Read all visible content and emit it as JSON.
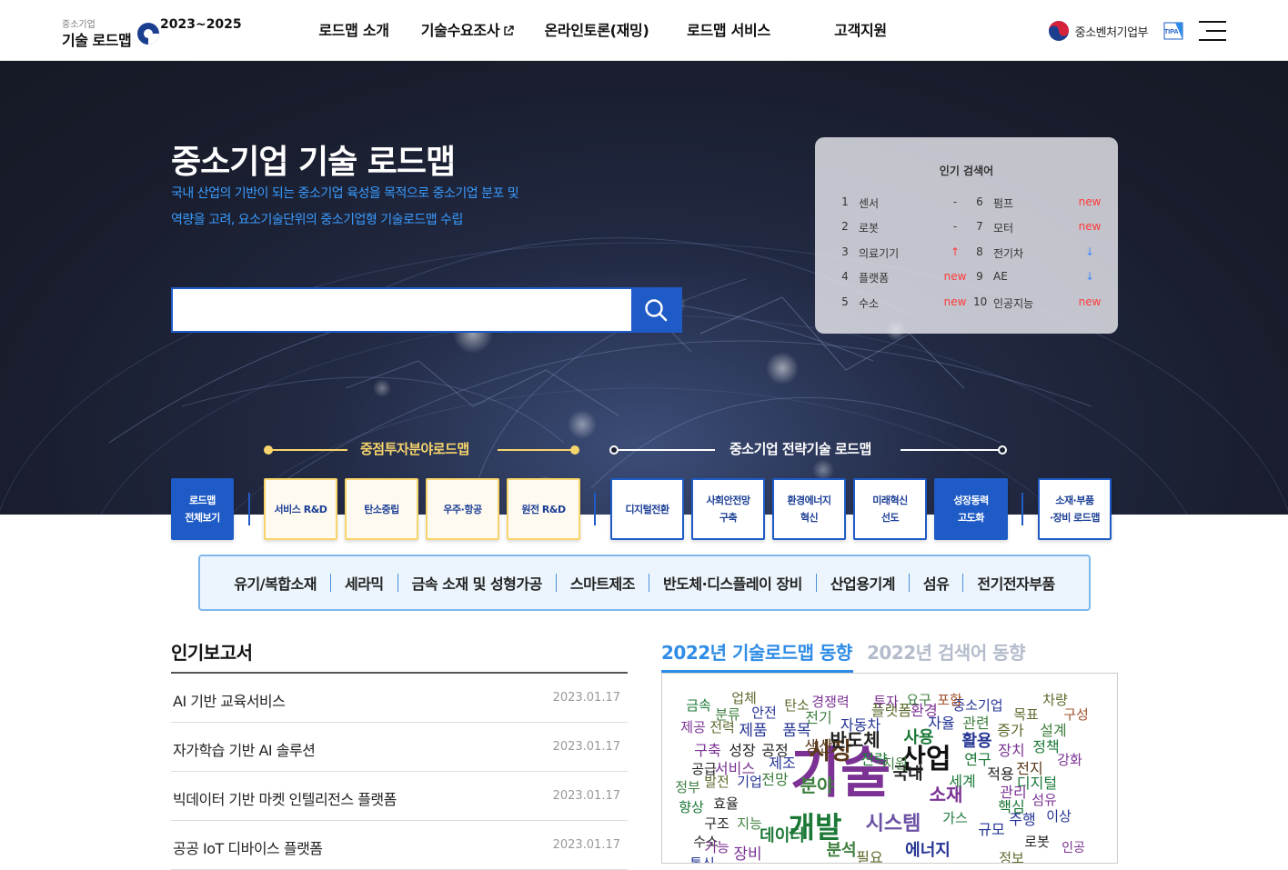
{
  "header": {
    "logo_small": "중소기업",
    "logo_main": "기술 로드맵",
    "logo_years": "2023~2025",
    "nav": [
      "로드맵 소개",
      "기술수요조사",
      "온라인토론(재밍)",
      "로드맵 서비스",
      "고객지원"
    ],
    "ministry": "중소벤처기업부",
    "tipa": "TIPA"
  },
  "hero": {
    "title": "중소기업 기술 로드맵",
    "desc1": "국내 산업의 기반이 되는 중소기업 육성을 목적으로 중소기업 분포 및",
    "desc2": "역량을 고려, 요소기술단위의 중소기업형 기술로드맵 수립",
    "search_placeholder": ""
  },
  "popular": {
    "title": "인기 검색어",
    "items": [
      {
        "rank": "1",
        "word": "센서",
        "trend": "-"
      },
      {
        "rank": "2",
        "word": "로봇",
        "trend": "-"
      },
      {
        "rank": "3",
        "word": "의료기기",
        "trend": "↑"
      },
      {
        "rank": "4",
        "word": "플랫폼",
        "trend": "new"
      },
      {
        "rank": "5",
        "word": "수소",
        "trend": "new"
      },
      {
        "rank": "6",
        "word": "펌프",
        "trend": "new"
      },
      {
        "rank": "7",
        "word": "모터",
        "trend": "new"
      },
      {
        "rank": "8",
        "word": "전기차",
        "trend": "↓"
      },
      {
        "rank": "9",
        "word": "AE",
        "trend": "↓"
      },
      {
        "rank": "10",
        "word": "인공지능",
        "trend": "new"
      }
    ]
  },
  "categories": {
    "focus_heading": "중점투자분야로드맵",
    "strategy_heading": "중소기업 전략기술 로드맵",
    "all": [
      "로드맵",
      "전체보기"
    ],
    "focus": [
      "서비스 R&D",
      "탄소중립",
      "우주·항공",
      "원전 R&D"
    ],
    "strategy": [
      [
        "디지털전환"
      ],
      [
        "사회안전망",
        "구축"
      ],
      [
        "환경에너지",
        "혁신"
      ],
      [
        "미래혁신",
        "선도"
      ],
      [
        "성장동력",
        "고도화"
      ]
    ],
    "materials": [
      "소재·부품",
      "·장비 로드맵"
    ],
    "sub": [
      "유기/복합소재",
      "세라믹",
      "금속 소재 및 성형가공",
      "스마트제조",
      "반도체·디스플레이 장비",
      "산업용기계",
      "섬유",
      "전기전자부품"
    ]
  },
  "reports": {
    "title": "인기보고서",
    "items": [
      {
        "title": "AI 기반 교육서비스",
        "date": "2023.01.17"
      },
      {
        "title": "자가학습 기반 AI 솔루션",
        "date": "2023.01.17"
      },
      {
        "title": "빅데이터 기반 마켓 인텔리전스 플랫폼",
        "date": "2023.01.17"
      },
      {
        "title": "공공 IoT 디바이스 플랫폼",
        "date": "2023.01.17"
      }
    ]
  },
  "trends": {
    "tab_active": "2022년 기술로드맵 동향",
    "tab_inactive": "2022년 검색어 동향",
    "words": [
      {
        "t": "기술",
        "c": "#7b3294"
      },
      {
        "t": "개발",
        "c": "#1b7837"
      },
      {
        "t": "산업",
        "c": "#111111"
      },
      {
        "t": "시장",
        "c": "#5a3a1a"
      },
      {
        "t": "시스템",
        "c": "#6a51a3"
      },
      {
        "t": "소재",
        "c": "#7b3294"
      },
      {
        "t": "반도체",
        "c": "#222222"
      },
      {
        "t": "사용",
        "c": "#1b7837"
      },
      {
        "t": "분야",
        "c": "#3f7f3f"
      },
      {
        "t": "에너지",
        "c": "#253494"
      },
      {
        "t": "플랫폼",
        "c": "#5c6b2e"
      },
      {
        "t": "제조",
        "c": "#253494"
      },
      {
        "t": "국내",
        "c": "#222222"
      },
      {
        "t": "환경",
        "c": "#7b3294"
      },
      {
        "t": "활용",
        "c": "#253494"
      },
      {
        "t": "연구",
        "c": "#1b7837"
      },
      {
        "t": "전략",
        "c": "#1b7837"
      },
      {
        "t": "규모",
        "c": "#253494"
      },
      {
        "t": "데이터",
        "c": "#1b7837"
      },
      {
        "t": "분석",
        "c": "#3f7f3f"
      },
      {
        "t": "중소기업",
        "c": "#253494"
      },
      {
        "t": "금속",
        "c": "#1b7837"
      },
      {
        "t": "분류",
        "c": "#3f7f3f"
      },
      {
        "t": "안전",
        "c": "#253494"
      },
      {
        "t": "탄소",
        "c": "#5c6b2e"
      },
      {
        "t": "경쟁력",
        "c": "#7b3294"
      },
      {
        "t": "투자",
        "c": "#7b3294"
      },
      {
        "t": "요구",
        "c": "#3f7f3f"
      },
      {
        "t": "포함",
        "c": "#a0522d"
      },
      {
        "t": "차량",
        "c": "#5c6b2e"
      },
      {
        "t": "업체",
        "c": "#5c6b2e"
      },
      {
        "t": "목표",
        "c": "#5c6b2e"
      },
      {
        "t": "구성",
        "c": "#a0522d"
      },
      {
        "t": "제공",
        "c": "#7b3294"
      },
      {
        "t": "전력",
        "c": "#5c6b2e"
      },
      {
        "t": "제품",
        "c": "#253494"
      },
      {
        "t": "품목",
        "c": "#253494"
      },
      {
        "t": "생산",
        "c": "#5a3a1a"
      },
      {
        "t": "전기",
        "c": "#3f7f3f"
      },
      {
        "t": "자동차",
        "c": "#253494"
      },
      {
        "t": "자율",
        "c": "#253494"
      },
      {
        "t": "관련",
        "c": "#3f7f3f"
      },
      {
        "t": "증가",
        "c": "#5c6b2e"
      },
      {
        "t": "설계",
        "c": "#3f7f3f"
      },
      {
        "t": "구축",
        "c": "#7b3294"
      },
      {
        "t": "성장",
        "c": "#222222"
      },
      {
        "t": "공정",
        "c": "#222222"
      },
      {
        "t": "장치",
        "c": "#7b3294"
      },
      {
        "t": "정책",
        "c": "#1b7837"
      },
      {
        "t": "공급",
        "c": "#222222"
      },
      {
        "t": "서비스",
        "c": "#7b3294"
      },
      {
        "t": "지원",
        "c": "#3f7f3f"
      },
      {
        "t": "적용",
        "c": "#222222"
      },
      {
        "t": "전지",
        "c": "#5a3a1a"
      },
      {
        "t": "강화",
        "c": "#7b3294"
      },
      {
        "t": "정부",
        "c": "#3f7f3f"
      },
      {
        "t": "발전",
        "c": "#5c6b2e"
      },
      {
        "t": "기업",
        "c": "#253494"
      },
      {
        "t": "전망",
        "c": "#3f7f3f"
      },
      {
        "t": "세계",
        "c": "#1b7837"
      },
      {
        "t": "디지털",
        "c": "#1b7837"
      },
      {
        "t": "향상",
        "c": "#1b7837"
      },
      {
        "t": "효율",
        "c": "#222222"
      },
      {
        "t": "핵심",
        "c": "#1b7837"
      },
      {
        "t": "관리",
        "c": "#7b3294"
      },
      {
        "t": "섬유",
        "c": "#7b3294"
      },
      {
        "t": "구조",
        "c": "#222222"
      },
      {
        "t": "지능",
        "c": "#3f7f3f"
      },
      {
        "t": "가스",
        "c": "#1b7837"
      },
      {
        "t": "주행",
        "c": "#253494"
      },
      {
        "t": "이상",
        "c": "#253494"
      },
      {
        "t": "수소",
        "c": "#222222"
      },
      {
        "t": "기능",
        "c": "#7b3294"
      },
      {
        "t": "로봇",
        "c": "#222222"
      },
      {
        "t": "인공",
        "c": "#7b3294"
      },
      {
        "t": "통신",
        "c": "#253494"
      },
      {
        "t": "장비",
        "c": "#7b3294"
      },
      {
        "t": "필요",
        "c": "#5c6b2e"
      },
      {
        "t": "정보",
        "c": "#5c6b2e"
      }
    ]
  }
}
